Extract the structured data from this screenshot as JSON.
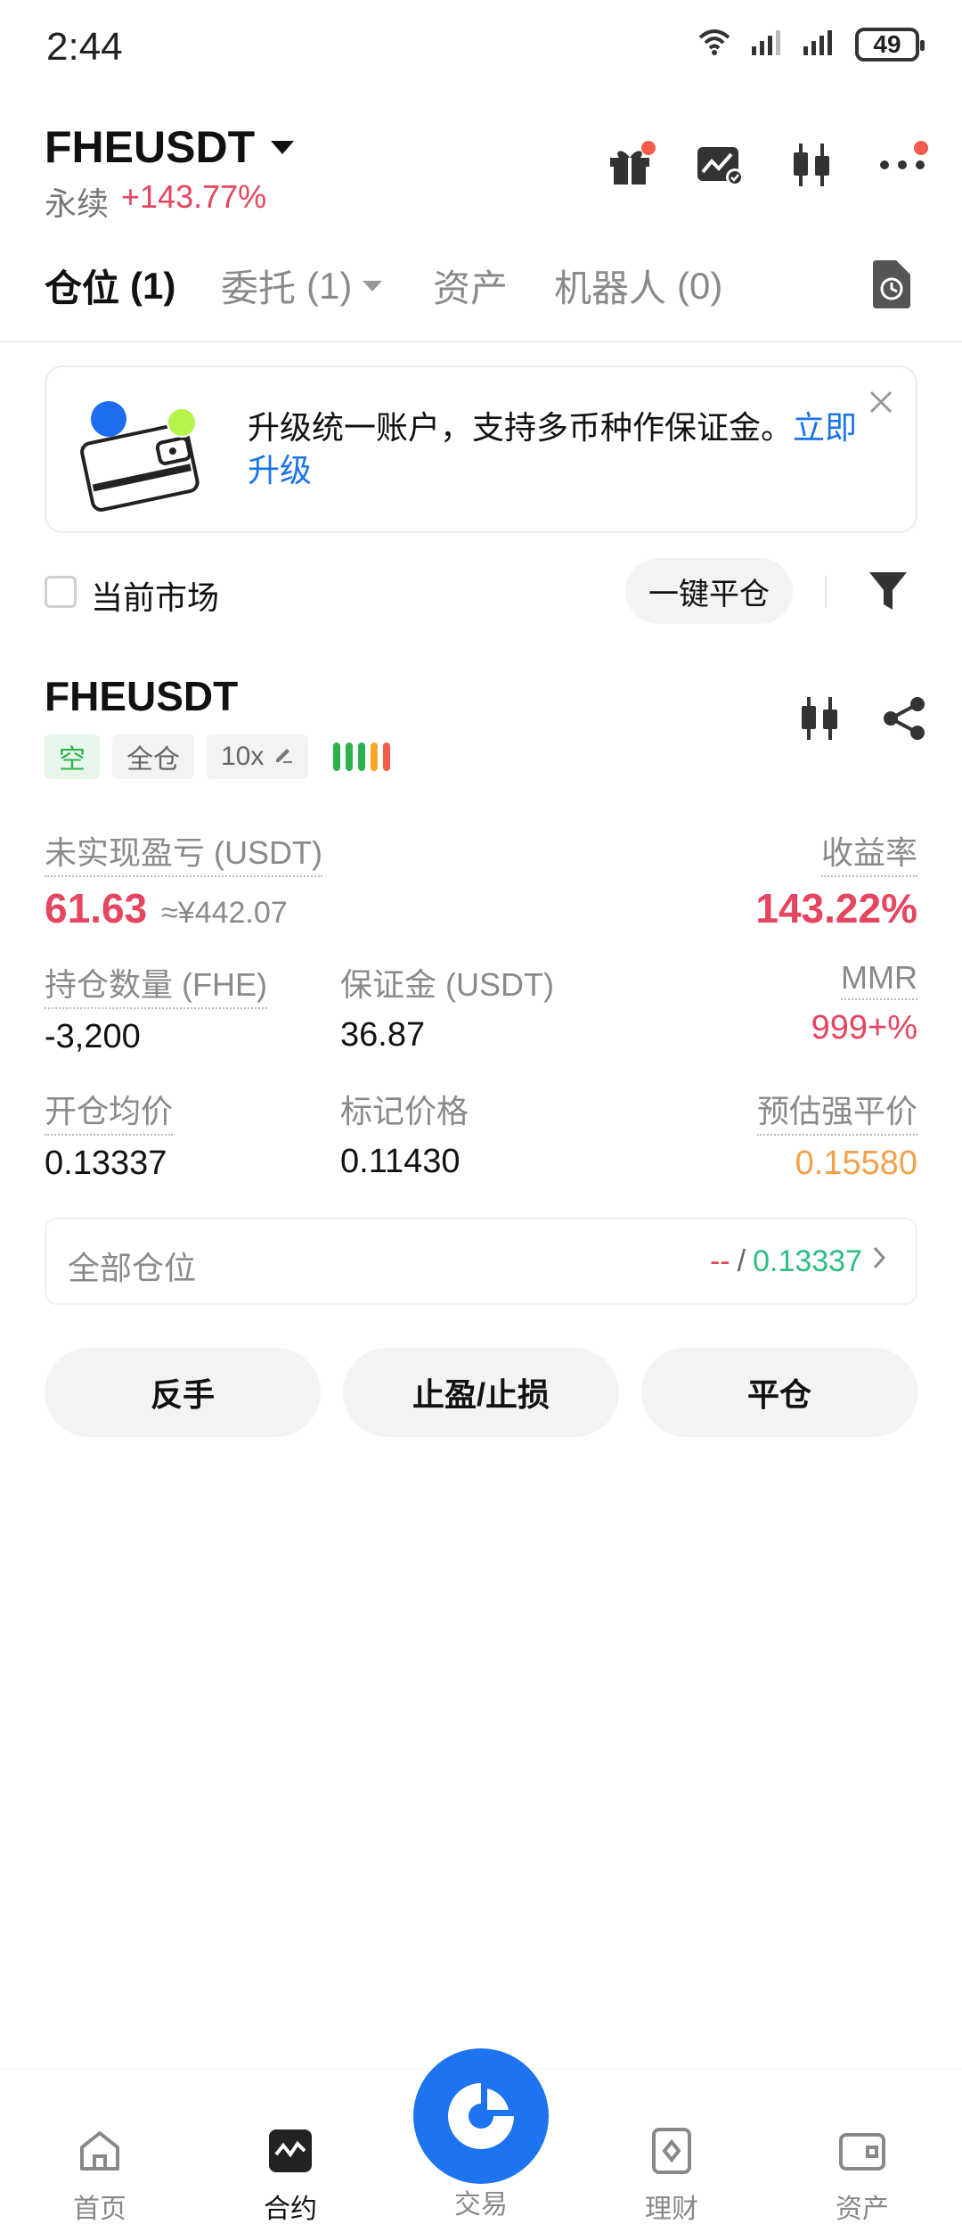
{
  "status_bar": {
    "time": "2:44",
    "battery": "49",
    "network": "6"
  },
  "header": {
    "pair": "FHEUSDT",
    "type_label": "永续",
    "change": "+143.77%",
    "icons": [
      "gift-icon",
      "chart-settings-icon",
      "candlestick-icon",
      "more-icon"
    ]
  },
  "tabs": [
    {
      "label": "仓位",
      "count": "(1)"
    },
    {
      "label": "委托",
      "count": "(1)"
    },
    {
      "label": "资产",
      "count": ""
    },
    {
      "label": "机器人",
      "count": "(0)"
    }
  ],
  "banner": {
    "text": "升级统一账户，支持多币种作保证金。",
    "link": "立即升级"
  },
  "filter": {
    "current_market_label": "当前市场",
    "close_all_label": "一键平仓"
  },
  "position": {
    "symbol": "FHEUSDT",
    "side_tag": "空",
    "margin_mode_tag": "全仓",
    "leverage_tag": "10x",
    "risk_colors": [
      "#2bb24c",
      "#2bb24c",
      "#2bb24c",
      "#f5a623",
      "#f25c4a"
    ],
    "unrealized_pnl_label": "未实现盈亏 (USDT)",
    "unrealized_pnl": "61.63",
    "unrealized_pnl_cny": "≈¥442.07",
    "roi_label": "收益率",
    "roi": "143.22%",
    "size_label": "持仓数量 (FHE)",
    "size": "-3,200",
    "margin_label": "保证金 (USDT)",
    "margin": "36.87",
    "mmr_label": "MMR",
    "mmr": "999+%",
    "entry_label": "开仓均价",
    "entry_price": "0.13337",
    "mark_label": "标记价格",
    "mark_price": "0.11430",
    "liq_label": "预估强平价",
    "liq_price": "0.15580"
  },
  "all_positions": {
    "label": "全部仓位",
    "dash": "--",
    "slash": "/",
    "value": "0.13337"
  },
  "actions": {
    "reverse": "反手",
    "tp_sl": "止盈/止损",
    "close": "平仓"
  },
  "bottom_nav": {
    "home": "首页",
    "futures": "合约",
    "trade": "交易",
    "earn": "理财",
    "assets": "资产"
  },
  "colors": {
    "red": "#e5455f",
    "green": "#2bb24c",
    "orange": "#f5a04a",
    "blue": "#1e73f0",
    "teal": "#2ebd85"
  }
}
